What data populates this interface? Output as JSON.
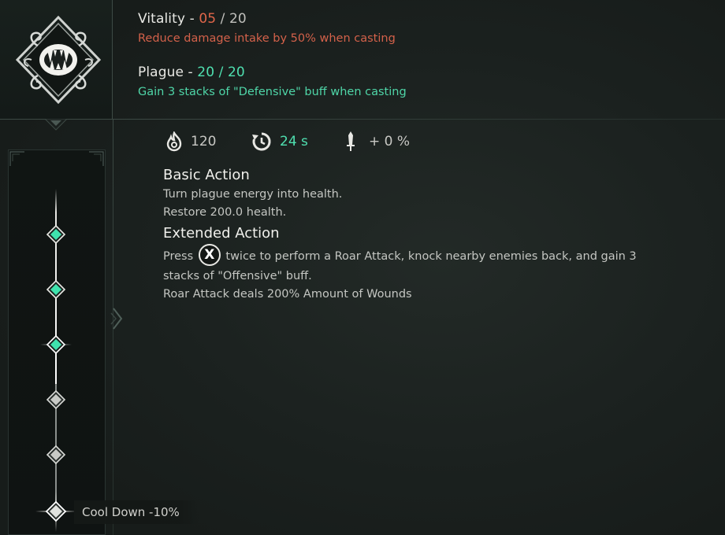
{
  "traits": [
    {
      "name": "Vitality",
      "current": "05",
      "max": "20",
      "description": "Reduce damage intake by 50% when casting"
    },
    {
      "name": "Plague",
      "current": "20",
      "max": "20",
      "description": "Gain 3 stacks of \"Defensive\" buff when casting"
    }
  ],
  "stats": {
    "energy_cost": "120",
    "cooldown": "24 s",
    "damage_bonus": "+ 0 %"
  },
  "basic_action": {
    "title": "Basic Action",
    "line1": "Turn plague energy into health.",
    "line2": "Restore 200.0 health."
  },
  "extended_action": {
    "title": "Extended Action",
    "press_word": "Press",
    "button_glyph": "X",
    "line1_rest": "twice to perform a Roar Attack, knock nearby enemies back, and gain 3",
    "line2": "stacks of \"Offensive\" buff.",
    "line3": "Roar Attack deals 200% Amount of Wounds"
  },
  "progression": {
    "unlocked_nodes": 3,
    "total_nodes": 6,
    "selected_node_label": "Cool Down -10%"
  },
  "colors": {
    "accent_green": "#4fe0b0",
    "accent_red": "#e0664a"
  }
}
